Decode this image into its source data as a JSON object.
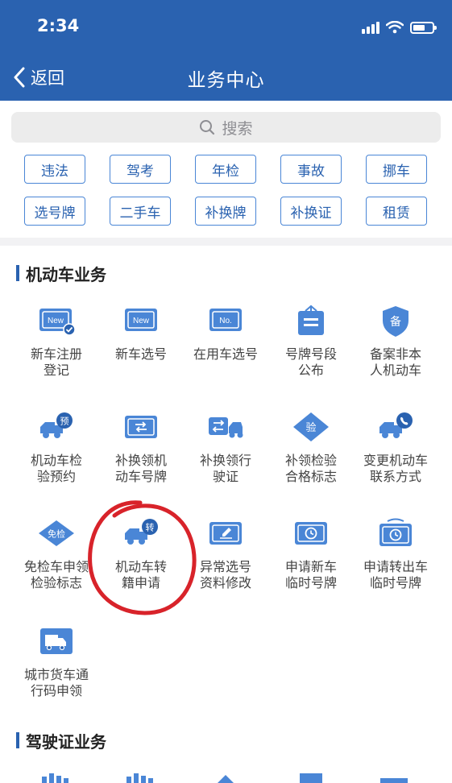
{
  "status_bar": {
    "time": "2:34"
  },
  "nav": {
    "back_label": "返回",
    "title": "业务中心"
  },
  "search": {
    "placeholder": "搜索"
  },
  "quick_tags": {
    "row1": [
      "违法",
      "驾考",
      "年检",
      "事故",
      "挪车"
    ],
    "row2": [
      "选号牌",
      "二手车",
      "补换牌",
      "补换证",
      "租赁"
    ]
  },
  "sections": {
    "vehicle": {
      "title": "机动车业务",
      "items": [
        {
          "label": "新车注册\n登记",
          "icon": "new-registration-icon"
        },
        {
          "label": "新车选号",
          "icon": "new-plate-icon"
        },
        {
          "label": "在用车选号",
          "icon": "no-plate-icon"
        },
        {
          "label": "号牌号段\n公布",
          "icon": "plate-announcement-icon"
        },
        {
          "label": "备案非本\n人机动车",
          "icon": "filing-shield-icon"
        },
        {
          "label": "机动车检\n验预约",
          "icon": "inspection-booking-icon"
        },
        {
          "label": "补换领机\n动车号牌",
          "icon": "plate-exchange-icon"
        },
        {
          "label": "补换领行\n驶证",
          "icon": "license-exchange-icon"
        },
        {
          "label": "补领检验\n合格标志",
          "icon": "inspection-mark-icon"
        },
        {
          "label": "变更机动车\n联系方式",
          "icon": "contact-change-icon"
        },
        {
          "label": "免检车申领\n检验标志",
          "icon": "exempt-inspection-icon"
        },
        {
          "label": "机动车转\n籍申请",
          "icon": "transfer-icon"
        },
        {
          "label": "异常选号\n资料修改",
          "icon": "edit-plate-icon"
        },
        {
          "label": "申请新车\n临时号牌",
          "icon": "temp-plate-icon"
        },
        {
          "label": "申请转出车\n临时号牌",
          "icon": "temp-plate-out-icon"
        },
        {
          "label": "城市货车通\n行码申领",
          "icon": "truck-pass-icon"
        }
      ]
    },
    "driver": {
      "title": "驾驶证业务"
    }
  },
  "colors": {
    "brand": "#2a62b0",
    "accent": "#4a86d6",
    "annotation": "#d8232a"
  }
}
